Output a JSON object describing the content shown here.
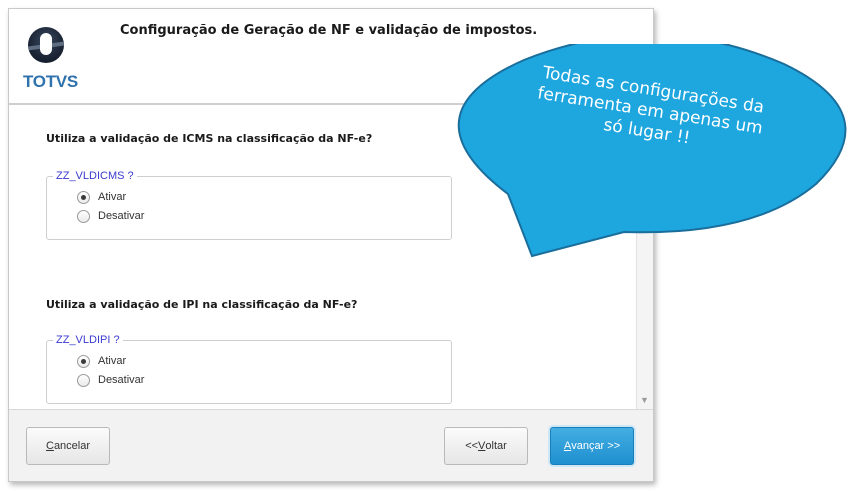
{
  "dialog": {
    "title": "Configuração de Geração de NF e validação de impostos.",
    "logo_text": "TOTVS"
  },
  "questions": [
    {
      "text": "Utiliza a validação de ICMS na classificação da NF-e?",
      "param": "ZZ_VLDICMS ?",
      "options": [
        "Ativar",
        "Desativar"
      ],
      "selected": "Ativar"
    },
    {
      "text": "Utiliza a validação de IPI na classificação da NF-e?",
      "param": "ZZ_VLDIPI ?",
      "options": [
        "Ativar",
        "Desativar"
      ],
      "selected": "Ativar"
    }
  ],
  "footer": {
    "cancel_prefix": "",
    "cancel_accel": "C",
    "cancel_rest": "ancelar",
    "back_prefix": "<< ",
    "back_accel": "V",
    "back_rest": "oltar",
    "next_prefix": "",
    "next_accel": "A",
    "next_rest": "vançar >>"
  },
  "callout": {
    "line1": "Todas as configurações da",
    "line2": "ferramenta em apenas um",
    "line3": "só lugar !!",
    "fill_color": "#1ea6df",
    "border_color": "#1a6e9c"
  },
  "colors": {
    "logo_blue": "#2f72ad",
    "group_label": "#3a3ad0",
    "primary_button": "#2a9ad6"
  }
}
